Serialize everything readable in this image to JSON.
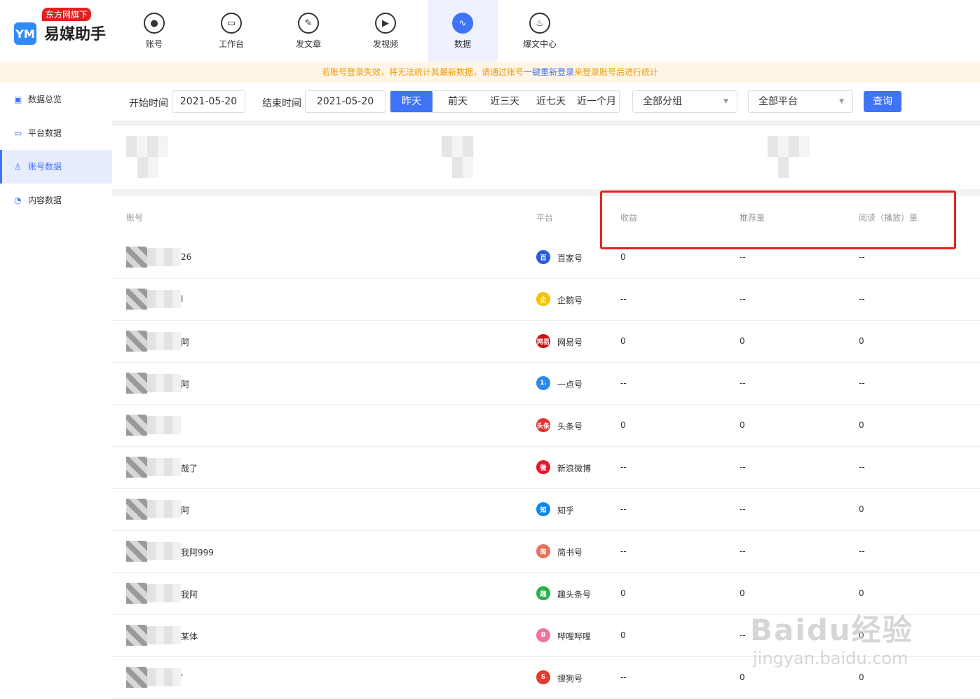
{
  "app": {
    "badge": "东方网旗下",
    "name": "易媒助手",
    "logo": "YM"
  },
  "nav": [
    {
      "label": "账号",
      "icon": "user-icon"
    },
    {
      "label": "工作台",
      "icon": "monitor-icon"
    },
    {
      "label": "发文章",
      "icon": "feather-icon"
    },
    {
      "label": "发视频",
      "icon": "play-icon"
    },
    {
      "label": "数据",
      "icon": "chart-icon",
      "active": true
    },
    {
      "label": "爆文中心",
      "icon": "fire-icon"
    }
  ],
  "notice": {
    "text1": "若账号登录失效，将无法统计其最新数据，请通过账号",
    "link": "一键重新登录",
    "text2": "来登录账号后进行统计"
  },
  "sidebar": [
    {
      "label": "数据总览",
      "icon": "chart-icon"
    },
    {
      "label": "平台数据",
      "icon": "monitor-icon"
    },
    {
      "label": "账号数据",
      "icon": "user-icon",
      "active": true
    },
    {
      "label": "内容数据",
      "icon": "pie-icon"
    }
  ],
  "filter": {
    "start_label": "开始时间",
    "start_value": "2021-05-20",
    "end_label": "结束时间",
    "end_value": "2021-05-20",
    "ranges": [
      "昨天",
      "前天",
      "近三天",
      "近七天",
      "近一个月"
    ],
    "active_range": "昨天",
    "group": "全部分组",
    "platform": "全部平台",
    "query": "查询"
  },
  "table": {
    "headers": {
      "account": "账号",
      "platform": "平台",
      "income": "收益",
      "recommend": "推荐量",
      "read": "阅读（播放）量"
    },
    "rows": [
      {
        "account": "26",
        "platform": "百家号",
        "pcolor": "#2b5cd8",
        "pglyph": "百",
        "income": "0",
        "recommend": "--",
        "read": "--"
      },
      {
        "account": "l",
        "platform": "企鹅号",
        "pcolor": "#f5c400",
        "pglyph": "企",
        "income": "--",
        "recommend": "--",
        "read": "--"
      },
      {
        "account": "阿",
        "platform": "网易号",
        "pcolor": "#c8161d",
        "pglyph": "网易",
        "income": "0",
        "recommend": "0",
        "read": "0"
      },
      {
        "account": "阿",
        "platform": "一点号",
        "pcolor": "#2a8be8",
        "pglyph": "1.",
        "income": "--",
        "recommend": "--",
        "read": "--"
      },
      {
        "account": "",
        "platform": "头条号",
        "pcolor": "#e8302f",
        "pglyph": "头条",
        "income": "0",
        "recommend": "0",
        "read": "0"
      },
      {
        "account": "哉了",
        "platform": "新浪微博",
        "pcolor": "#e6162d",
        "pglyph": "微",
        "income": "--",
        "recommend": "--",
        "read": "--"
      },
      {
        "account": "阿",
        "platform": "知乎",
        "pcolor": "#0f88eb",
        "pglyph": "知",
        "income": "--",
        "recommend": "--",
        "read": "0"
      },
      {
        "account": "我阿999",
        "platform": "简书号",
        "pcolor": "#ea6f5a",
        "pglyph": "简",
        "income": "--",
        "recommend": "--",
        "read": "--"
      },
      {
        "account": "我阿",
        "platform": "趣头条号",
        "pcolor": "#2bb24c",
        "pglyph": "趣",
        "income": "0",
        "recommend": "0",
        "read": "0"
      },
      {
        "account": "某体",
        "platform": "哔哩哔哩",
        "pcolor": "#f07399",
        "pglyph": "B",
        "income": "0",
        "recommend": "--",
        "read": "0"
      },
      {
        "account": "'",
        "platform": "搜狗号",
        "pcolor": "#e23b2f",
        "pglyph": "S",
        "income": "--",
        "recommend": "0",
        "read": "0"
      }
    ]
  },
  "watermark": {
    "main": "Baidu经验",
    "sub": "jingyan.baidu.com"
  }
}
